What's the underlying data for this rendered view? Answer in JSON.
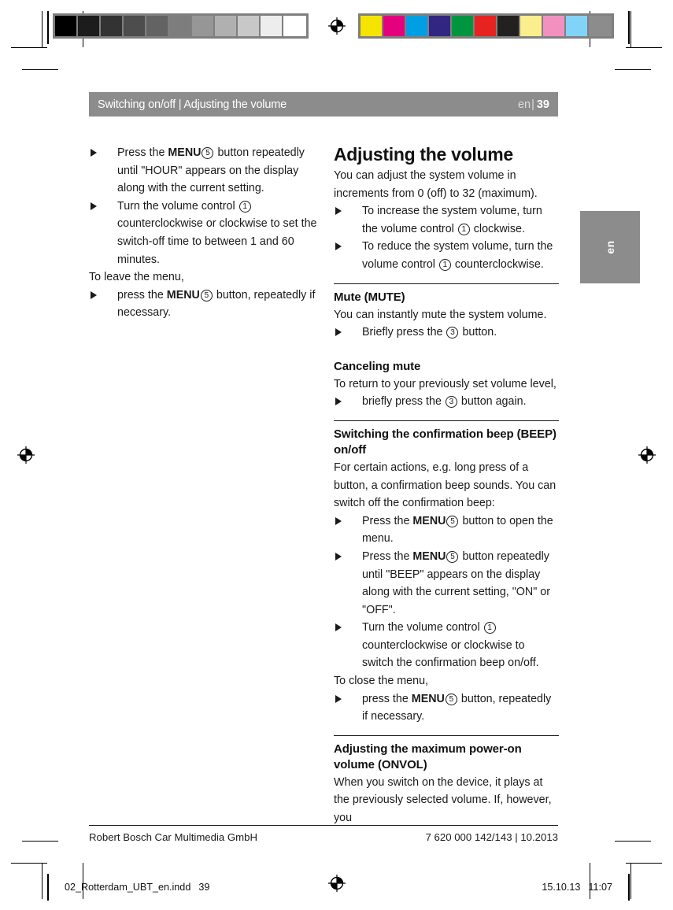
{
  "header": {
    "title": "Switching on/off | Adjusting the volume",
    "lang": "en",
    "separator": "|",
    "page": "39"
  },
  "side_tab": {
    "label": "en"
  },
  "left_column": {
    "items": [
      {
        "prefix": "Press the ",
        "keyword": "MENU",
        "ref": "5",
        "suffix": " button repeatedly until \"HOUR\" appears on the display along with the current setting."
      },
      {
        "prefix": "Turn the volume control ",
        "keyword": "",
        "ref": "1",
        "suffix": " counterclockwise or clockwise to set the switch-off time to between 1 and 60 minutes."
      }
    ],
    "closing_lead": "To leave the menu,",
    "closing_item": {
      "prefix": "press the ",
      "keyword": "MENU",
      "ref": "5",
      "suffix": " button, repeatedly if necessary."
    }
  },
  "right_column": {
    "title": "Adjusting the volume",
    "intro": "You can adjust the system volume in increments from 0 (off) to 32 (maximum).",
    "intro_items": [
      {
        "prefix": "To increase the system volume, turn the volume control ",
        "ref": "1",
        "suffix": " clockwise."
      },
      {
        "prefix": "To reduce the system volume, turn the volume control ",
        "ref": "1",
        "suffix": " counterclockwise."
      }
    ],
    "sections": [
      {
        "heading": "Mute (MUTE)",
        "body": "You can instantly mute the system volume.",
        "items": [
          {
            "prefix": "Briefly press the ",
            "ref": "3",
            "suffix": " button."
          }
        ]
      },
      {
        "heading": "Canceling mute",
        "body": "To return to your previously set volume level,",
        "items": [
          {
            "prefix": "briefly press the ",
            "ref": "3",
            "suffix": " button again."
          }
        ]
      },
      {
        "heading": "Switching the confirmation beep (BEEP) on/off",
        "body": "For certain actions, e.g. long press of a button, a confirmation beep sounds. You can switch off the confirmation beep:",
        "items": [
          {
            "prefix": "Press the ",
            "keyword": "MENU",
            "ref": "5",
            "suffix": " button to open the menu."
          },
          {
            "prefix": "Press the ",
            "keyword": "MENU",
            "ref": "5",
            "suffix": " button repeatedly until \"BEEP\" appears on the display along with the current setting, \"ON\" or \"OFF\"."
          },
          {
            "prefix": "Turn the volume control ",
            "ref": "1",
            "suffix": " counterclockwise or clockwise to switch the confirmation beep on/off."
          }
        ],
        "closing_lead": "To close the menu,",
        "closing_item": {
          "prefix": "press the ",
          "keyword": "MENU",
          "ref": "5",
          "suffix": " button, repeatedly if necessary."
        }
      },
      {
        "heading": "Adjusting the maximum power-on volume (ONVOL)",
        "body": "When you switch on the device, it plays at the previously selected volume. If, however, you",
        "items": []
      }
    ]
  },
  "footer": {
    "publisher": "Robert Bosch Car Multimedia GmbH",
    "document_id": "7 620 000 142/143 | 10.2013"
  },
  "print_slug": {
    "filename": "02_Rotterdam_UBT_en.indd",
    "page": "39",
    "date": "15.10.13",
    "time": "11:07"
  },
  "calibration": {
    "grayscale": [
      "#000000",
      "#1c1c1c",
      "#333333",
      "#4d4d4d",
      "#636363",
      "#7d7d7d",
      "#969696",
      "#b0b0b0",
      "#c8c8c8",
      "#ededed",
      "#ffffff"
    ],
    "colors": [
      "#f5e400",
      "#e5007d",
      "#009fe3",
      "#312783",
      "#009640",
      "#e62320",
      "#232120",
      "#fcee8c",
      "#f291c0",
      "#81d4f7",
      "#8c8c8c"
    ]
  }
}
